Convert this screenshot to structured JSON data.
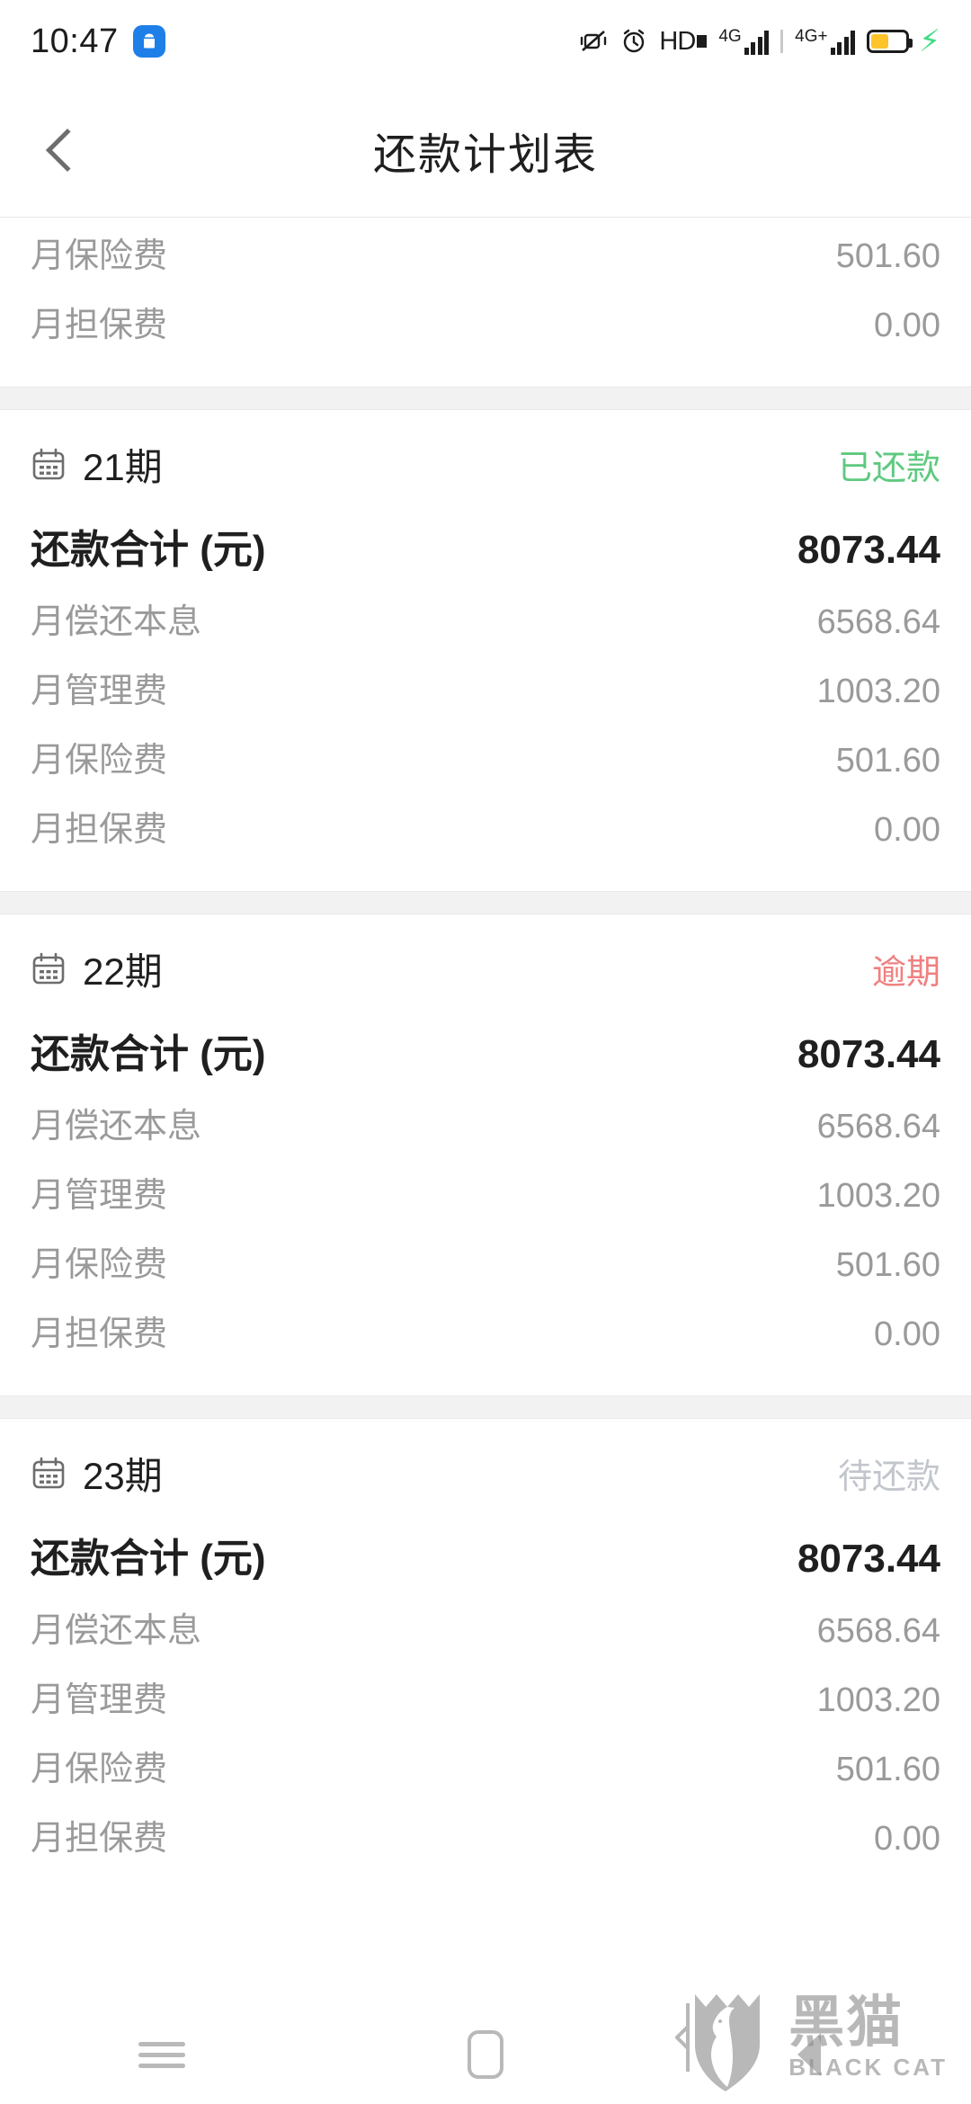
{
  "status_bar": {
    "time": "10:47",
    "app_icon": "android-robot-icon",
    "icons": [
      "vibrate-off-icon",
      "alarm-clock-icon",
      "hd-voice-icon",
      "signal-4g-icon",
      "signal-4g-plus-icon",
      "battery-charging-icon"
    ],
    "hd_label": "HD",
    "network_1": "4G",
    "network_2": "4G+"
  },
  "header": {
    "title": "还款计划表",
    "back_icon": "back-chevron-icon"
  },
  "colors": {
    "status_paid": "#5fc97f",
    "status_overdue": "#f08080",
    "status_pending": "#c2c6cc",
    "page_background": "#f2f2f2",
    "card_background": "#ffffff",
    "accent_battery": "#fdc52b"
  },
  "partial_card": {
    "rows": [
      {
        "label": "月保险费",
        "value": "501.60"
      },
      {
        "label": "月担保费",
        "value": "0.00"
      }
    ]
  },
  "cards": [
    {
      "period": "21期",
      "status": "已还款",
      "status_type": "paid",
      "total_label": "还款合计 (元)",
      "total_value": "8073.44",
      "rows": [
        {
          "label": "月偿还本息",
          "value": "6568.64"
        },
        {
          "label": "月管理费",
          "value": "1003.20"
        },
        {
          "label": "月保险费",
          "value": "501.60"
        },
        {
          "label": "月担保费",
          "value": "0.00"
        }
      ]
    },
    {
      "period": "22期",
      "status": "逾期",
      "status_type": "overdue",
      "total_label": "还款合计 (元)",
      "total_value": "8073.44",
      "rows": [
        {
          "label": "月偿还本息",
          "value": "6568.64"
        },
        {
          "label": "月管理费",
          "value": "1003.20"
        },
        {
          "label": "月保险费",
          "value": "501.60"
        },
        {
          "label": "月担保费",
          "value": "0.00"
        }
      ]
    },
    {
      "period": "23期",
      "status": "待还款",
      "status_type": "pending",
      "total_label": "还款合计 (元)",
      "total_value": "8073.44",
      "rows": [
        {
          "label": "月偿还本息",
          "value": "6568.64"
        },
        {
          "label": "月管理费",
          "value": "1003.20"
        },
        {
          "label": "月保险费",
          "value": "501.60"
        },
        {
          "label": "月担保费",
          "value": "0.00"
        }
      ]
    }
  ],
  "nav_bar": {
    "recents_icon": "menu-lines-icon",
    "home_icon": "home-rounded-rect-icon",
    "back_icon": "back-triangle-icon"
  },
  "watermark": {
    "cn": "黑猫",
    "en": "BLACK CAT",
    "logo": "black-cat-shield-icon"
  }
}
